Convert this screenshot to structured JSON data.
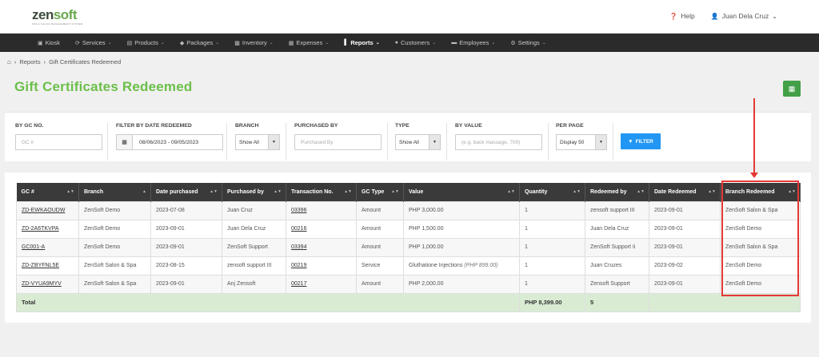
{
  "brand": {
    "logo_main": "zen",
    "logo_accent": "soft",
    "tagline": "SPA & SALON MANAGEMENT SYSTEM"
  },
  "top_right": {
    "help": "Help",
    "user": "Juan Dela Cruz"
  },
  "nav": [
    {
      "label": "Kiosk",
      "icon": "monitor-icon"
    },
    {
      "label": "Services",
      "icon": "refresh-icon"
    },
    {
      "label": "Products",
      "icon": "cart-icon"
    },
    {
      "label": "Packages",
      "icon": "tag-icon"
    },
    {
      "label": "Inventory",
      "icon": "boxes-icon"
    },
    {
      "label": "Expenses",
      "icon": "expense-icon"
    },
    {
      "label": "Reports",
      "icon": "chart-icon"
    },
    {
      "label": "Customers",
      "icon": "users-icon"
    },
    {
      "label": "Employees",
      "icon": "employee-icon"
    },
    {
      "label": "Settings",
      "icon": "gear-icon"
    }
  ],
  "breadcrumb": {
    "reports": "Reports",
    "current": "Gift Certificates Redeemed"
  },
  "page_title": "Gift Certificates Redeemed",
  "filters": {
    "gc_no": {
      "label": "BY GC NO.",
      "placeholder": "GC #"
    },
    "date": {
      "label": "FILTER BY DATE REDEEMED",
      "value": "08/06/2023 - 09/05/2023"
    },
    "branch": {
      "label": "BRANCH",
      "value": "Show All"
    },
    "purchased_by": {
      "label": "PURCHASED BY",
      "placeholder": "Purchased By"
    },
    "type": {
      "label": "TYPE",
      "value": "Show All"
    },
    "by_value": {
      "label": "BY VALUE",
      "placeholder": "(e.g. back massage, 700)"
    },
    "per_page": {
      "label": "PER PAGE",
      "value": "Display 50"
    },
    "filter_button": "FILTER"
  },
  "table": {
    "headers": [
      "GC #",
      "Branch",
      "Date purchased",
      "Purchased by",
      "Transaction No.",
      "GC Type",
      "Value",
      "Quantity",
      "Redeemed by",
      "Date Redeemed",
      "Branch Redeemed"
    ],
    "rows": [
      [
        "ZD-EWKAOUDW",
        "ZenSoft Demo",
        "2023-07-08",
        "Juan Cruz",
        "03396",
        "Amount",
        "PHP 3,000.00",
        "",
        "1",
        "zensoft support III",
        "2023-09-01",
        "ZenSoft Salon & Spa"
      ],
      [
        "ZD-2A6TKVPA",
        "ZenSoft Demo",
        "2023-09-01",
        "Juan Dela Cruz",
        "00216",
        "Amount",
        "PHP 1,500.00",
        "",
        "1",
        "Juan Dela Cruz",
        "2023-09-01",
        "ZenSoft Demo"
      ],
      [
        "GC001-A",
        "ZenSoft Demo",
        "2023-09-01",
        "ZenSoft Support",
        "03394",
        "Amount",
        "PHP 1,000.00",
        "",
        "1",
        "ZenSoft Support Ii",
        "2023-09-01",
        "ZenSoft Salon & Spa"
      ],
      [
        "ZD-ZBYFNL5E",
        "ZenSoft Salon & Spa",
        "2023-08-15",
        "zensoft support III",
        "00219",
        "Service",
        "Gluthatione Injections",
        "(PHP 899.00)",
        "1",
        "Juan Cruzes",
        "2023-09-02",
        "ZenSoft Demo"
      ],
      [
        "ZD-VYUA9MYV",
        "ZenSoft Salon & Spa",
        "2023-09-01",
        "Anj Zensoft",
        "00217",
        "Amount",
        "PHP 2,000.00",
        "",
        "1",
        "Zensoft Support",
        "2023-09-01",
        "ZenSoft Demo"
      ]
    ],
    "total": {
      "label": "Total",
      "value": "PHP 8,399.00",
      "quantity": "5"
    }
  },
  "annotation_color": "#e53935",
  "accent_color": "#6cbf4a"
}
